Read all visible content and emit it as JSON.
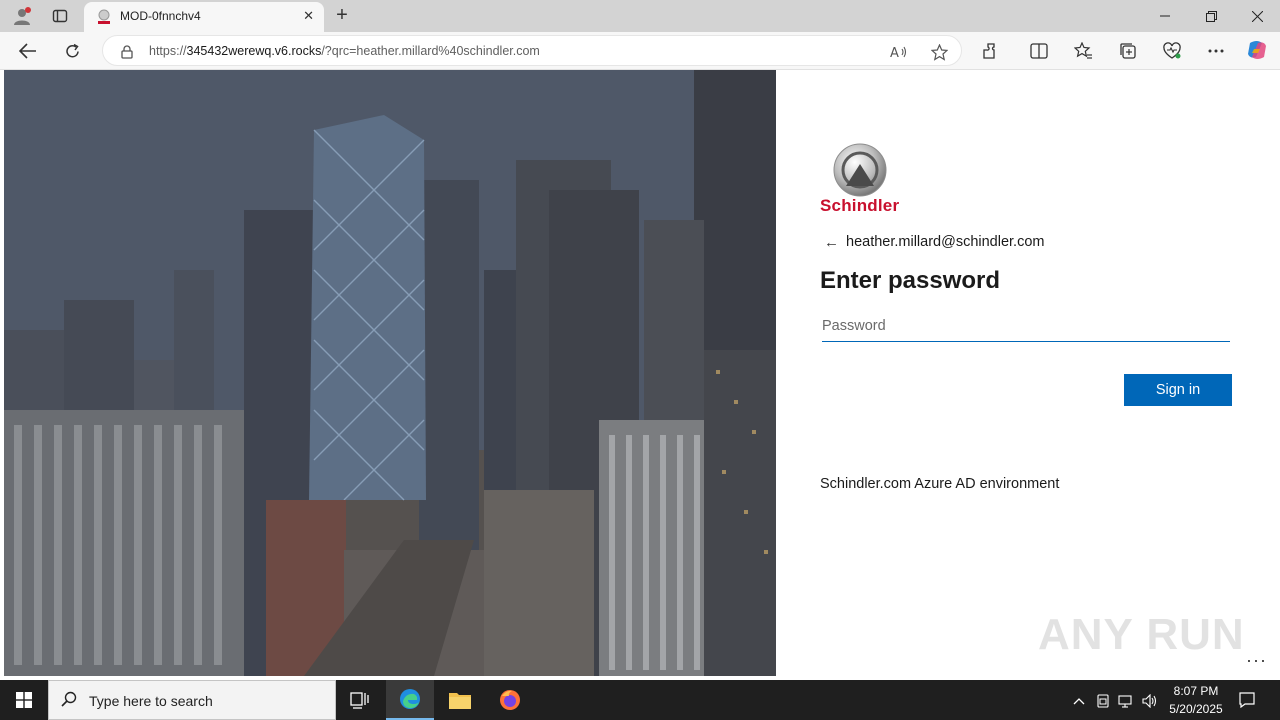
{
  "browser": {
    "tab_title": "MOD-0fnnchv4",
    "url_prefix": "https://",
    "url_host": "345432werewq.v6.rocks",
    "url_rest": "/?qrc=heather.millard%40schindler.com",
    "tab_close_glyph": "✕",
    "new_tab_glyph": "+"
  },
  "signin": {
    "brand": "Schindler",
    "back_glyph": "←",
    "identity": "heather.millard@schindler.com",
    "title": "Enter password",
    "password_placeholder": "Password",
    "button_label": "Sign in",
    "description": "Schindler.com Azure AD environment",
    "more_glyph": "···"
  },
  "watermark": "ANY RUN",
  "taskbar": {
    "search_placeholder": "Type here to search",
    "time": "8:07 PM",
    "date": "5/20/2025"
  },
  "colors": {
    "accent": "#0067b8",
    "brand_red": "#c8102e",
    "taskbar": "#1f1f1f"
  }
}
